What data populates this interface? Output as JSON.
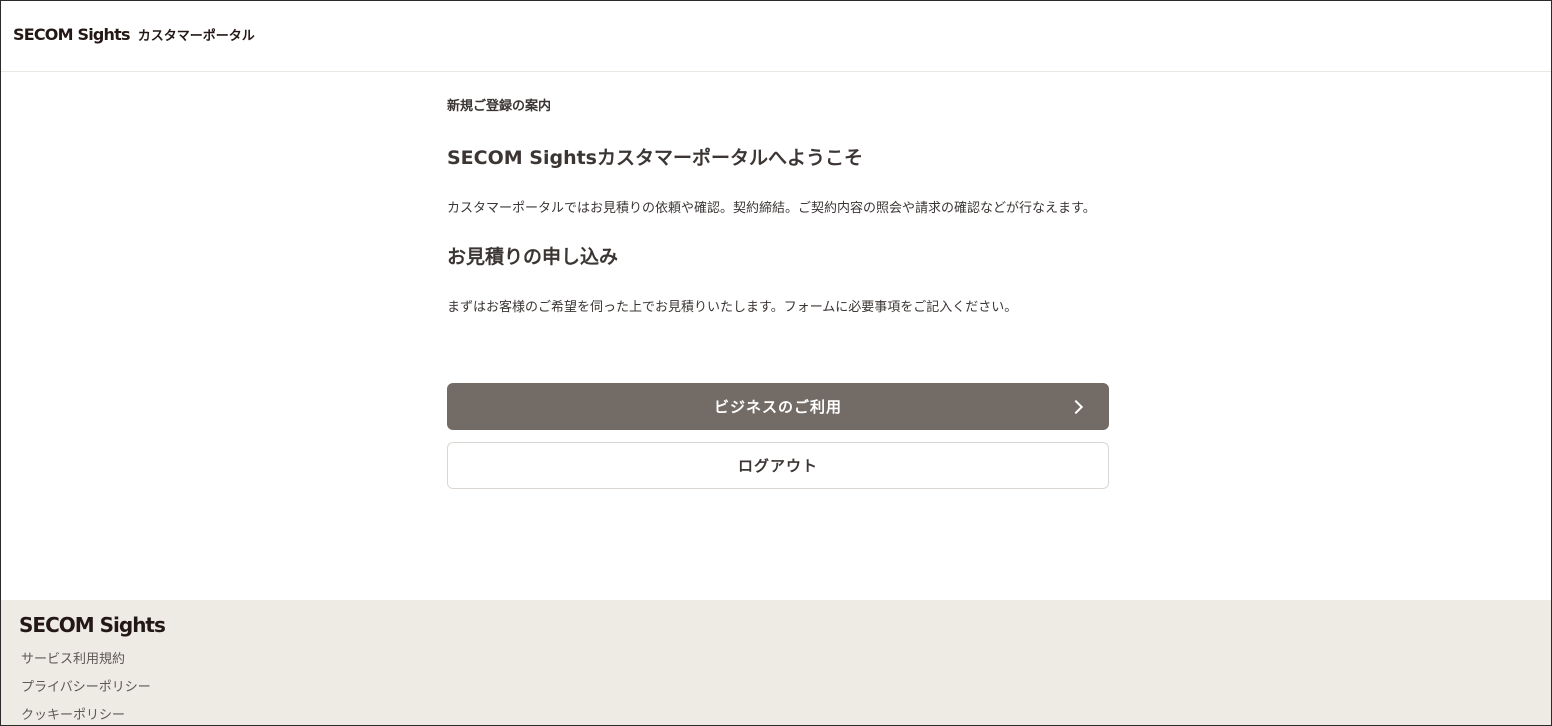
{
  "header": {
    "brand_logo": "SECOM Sights",
    "brand_sub": "カスタマーポータル"
  },
  "main": {
    "eyebrow": "新規ご登録の案内",
    "welcome_title": "SECOM Sightsカスタマーポータルへようこそ",
    "welcome_text": "カスタマーポータルではお見積りの依頼や確認。契約締結。ご契約内容の照会や請求の確認などが行なえます。",
    "quote_title": "お見積りの申し込み",
    "quote_text": "まずはお客様のご希望を伺った上でお見積りいたします。フォームに必要事項をご記入ください。",
    "business_button": "ビジネスのご利用",
    "logout_button": "ログアウト"
  },
  "footer": {
    "logo": "SECOM Sights",
    "links": [
      "サービス利用規約",
      "プライバシーポリシー",
      "クッキーポリシー"
    ]
  },
  "colors": {
    "primary_button": "#726b66",
    "footer_bg": "#eeeae4",
    "text": "#3b3634"
  },
  "icons": {
    "business_button_icon": "chevron-right-icon"
  }
}
